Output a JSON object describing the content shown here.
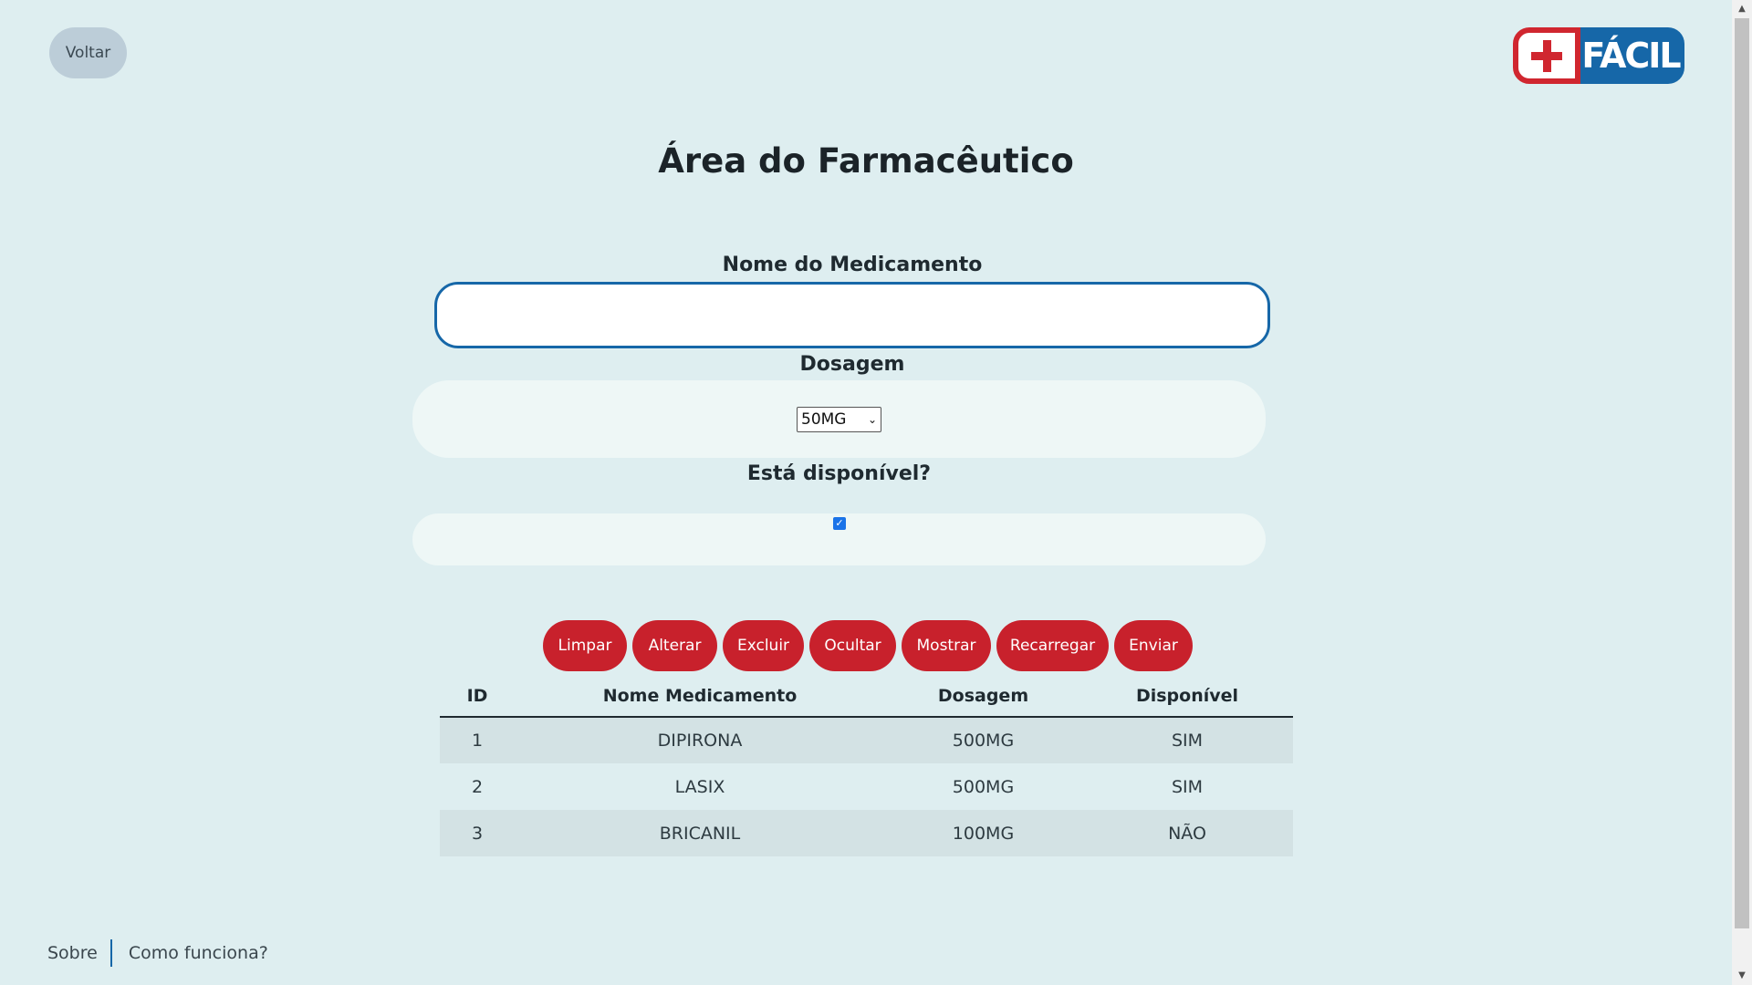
{
  "header": {
    "back_label": "Voltar",
    "logo_text": "FÁCIL"
  },
  "page_title": "Área do Farmacêutico",
  "form": {
    "name_label": "Nome do Medicamento",
    "name_value": "",
    "dose_label": "Dosagem",
    "dose_selected": "50MG",
    "available_label": "Está disponível?",
    "available_checked": true
  },
  "buttons": {
    "clear": "Limpar",
    "edit": "Alterar",
    "delete": "Excluir",
    "hide": "Ocultar",
    "show": "Mostrar",
    "reload": "Recarregar",
    "submit": "Enviar"
  },
  "table": {
    "headers": [
      "ID",
      "Nome Medicamento",
      "Dosagem",
      "Disponível"
    ],
    "rows": [
      [
        "1",
        "DIPIRONA",
        "500MG",
        "SIM"
      ],
      [
        "2",
        "LASIX",
        "500MG",
        "SIM"
      ],
      [
        "3",
        "BRICANIL",
        "100MG",
        "NÃO"
      ]
    ]
  },
  "footer": {
    "about": "Sobre",
    "how_it_works": "Como funciona?"
  },
  "colors": {
    "background": "#deeef0",
    "accent_red": "#c8212c",
    "brand_blue": "#1667a8"
  }
}
